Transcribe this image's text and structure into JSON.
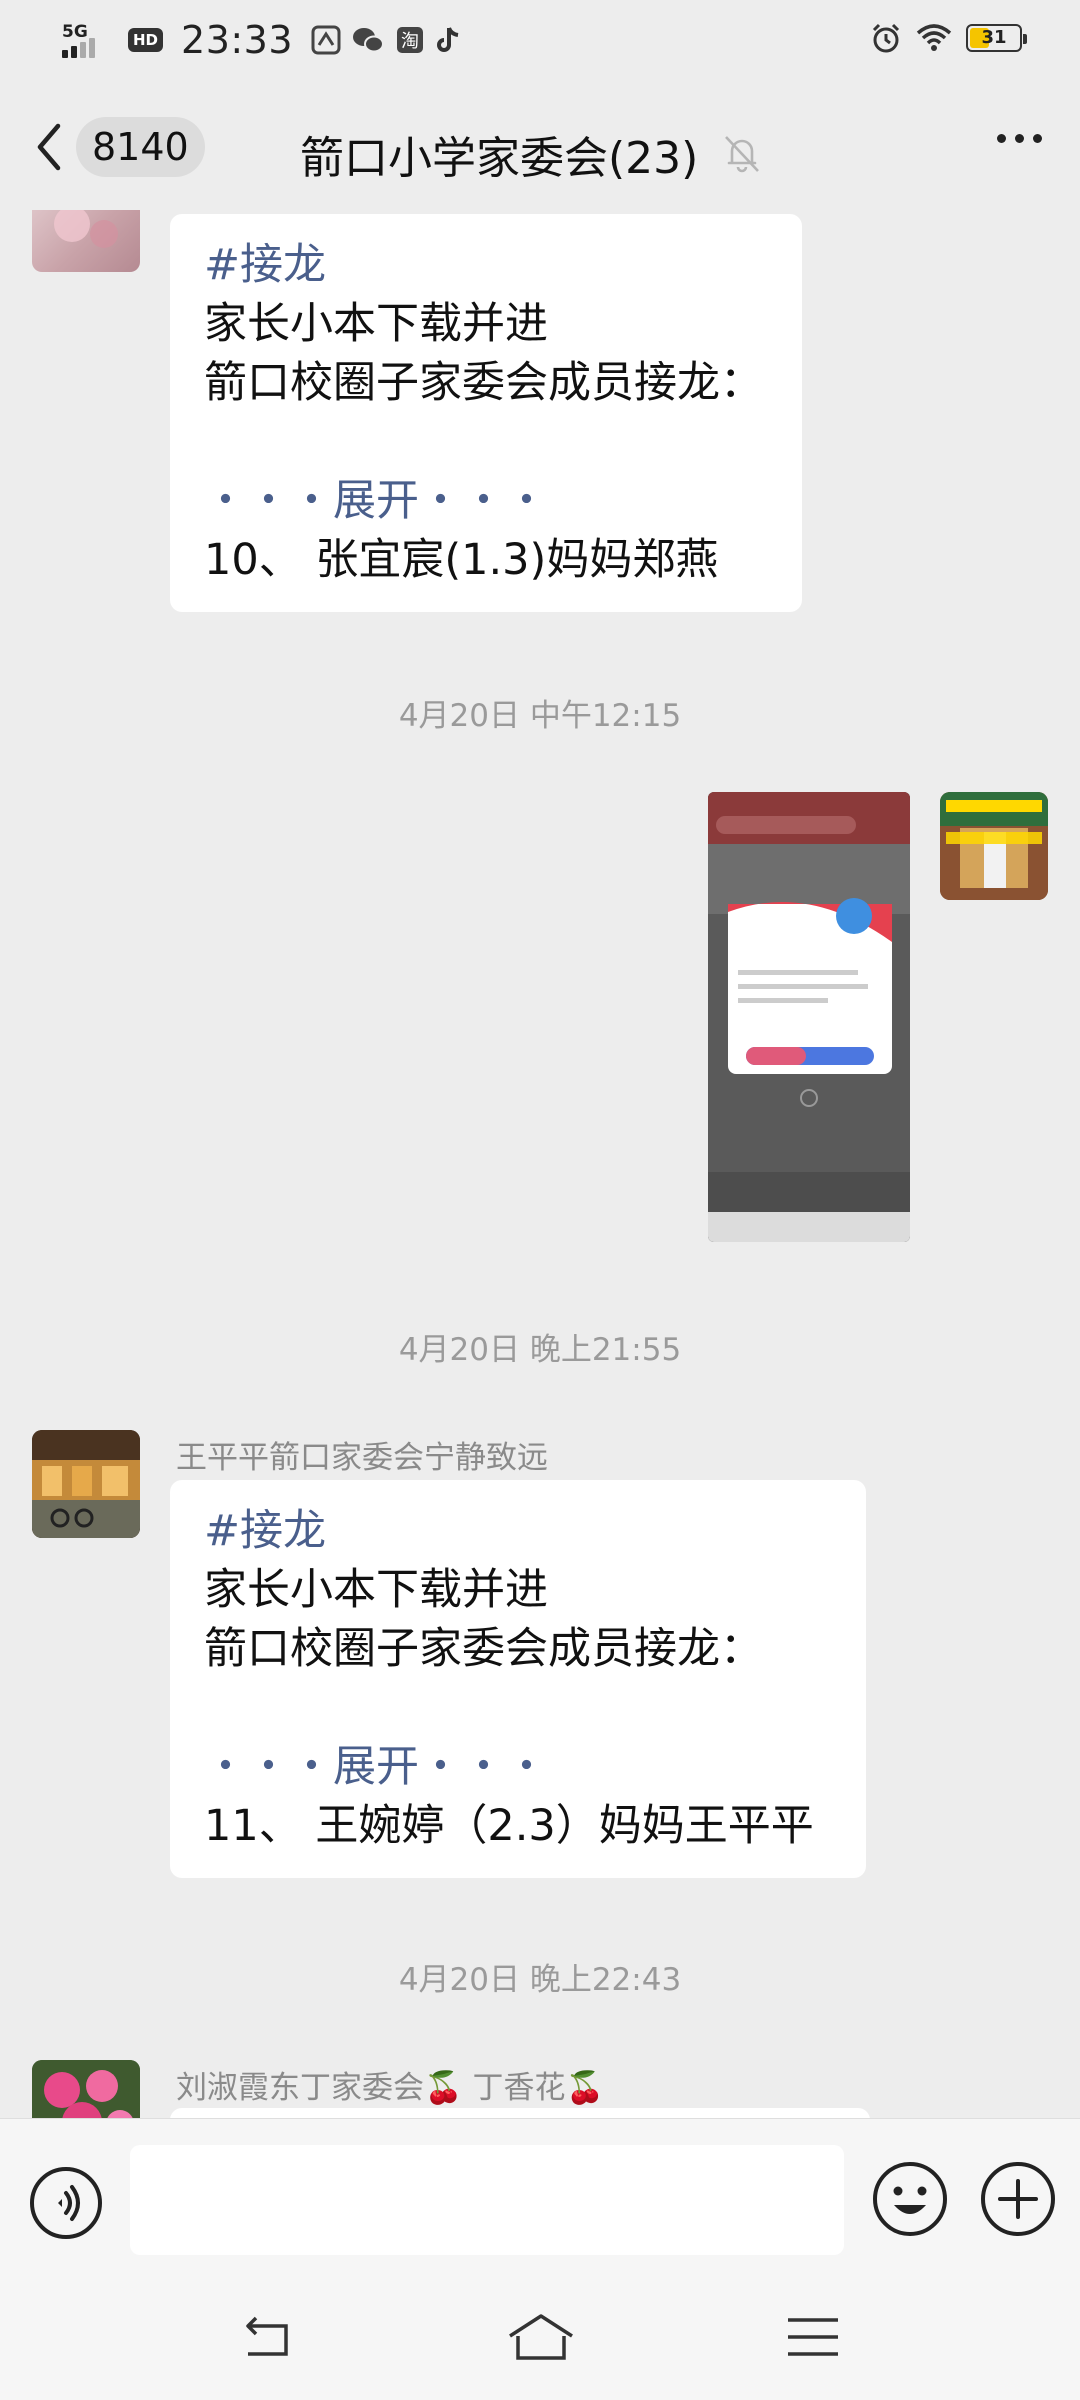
{
  "status_bar": {
    "network": "5G",
    "hd": "HD",
    "time": "23:33",
    "battery": "31"
  },
  "header": {
    "back_count": "8140",
    "title": "箭口小学家委会(23)"
  },
  "messages": [
    {
      "topic": "#接龙",
      "line1": "家长小本下载并进",
      "line2": "箭口校圈子家委会成员接龙：",
      "expand": "・・・展开・・・",
      "entry": "10、 张宜宸(1.3)妈妈郑燕"
    },
    {
      "sender": "王平平箭口家委会宁静致远",
      "topic": "#接龙",
      "line1": "家长小本下载并进",
      "line2": "箭口校圈子家委会成员接龙：",
      "expand": "・・・展开・・・",
      "entry": "11、 王婉婷（2.3）妈妈王平平"
    },
    {
      "sender": "刘淑霞东丁家委会🍒 丁香花🍒"
    }
  ],
  "timestamps": {
    "t1": "4月20日 中午12:15",
    "t2": "4月20日 晚上21:55",
    "t3": "4月20日 晚上22:43"
  },
  "colors": {
    "background": "#ededed",
    "topic_link": "#4a5f8c",
    "battery_fill": "#f5c400"
  }
}
